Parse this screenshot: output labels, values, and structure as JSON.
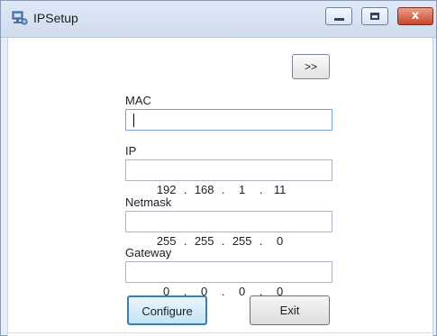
{
  "window": {
    "title": "IPSetup",
    "minimize": "minimize",
    "maximize": "maximize",
    "close_glyph": "x"
  },
  "toolbar": {
    "more_label": ">>"
  },
  "form": {
    "mac": {
      "label": "MAC",
      "value": ""
    },
    "ip": {
      "label": "IP",
      "octets": [
        "192",
        "168",
        "1",
        "11"
      ]
    },
    "netmask": {
      "label": "Netmask",
      "octets": [
        "255",
        "255",
        "255",
        "0"
      ]
    },
    "gateway": {
      "label": "Gateway",
      "octets": [
        "0",
        "0",
        "0",
        "0"
      ]
    }
  },
  "buttons": {
    "configure": "Configure",
    "exit": "Exit"
  },
  "icons": {
    "app": "network-app-icon",
    "close": "close-icon"
  },
  "colors": {
    "titlebar": "#d8e4f3",
    "close_button": "#c9462b",
    "focus_border": "#3c7fb1"
  }
}
